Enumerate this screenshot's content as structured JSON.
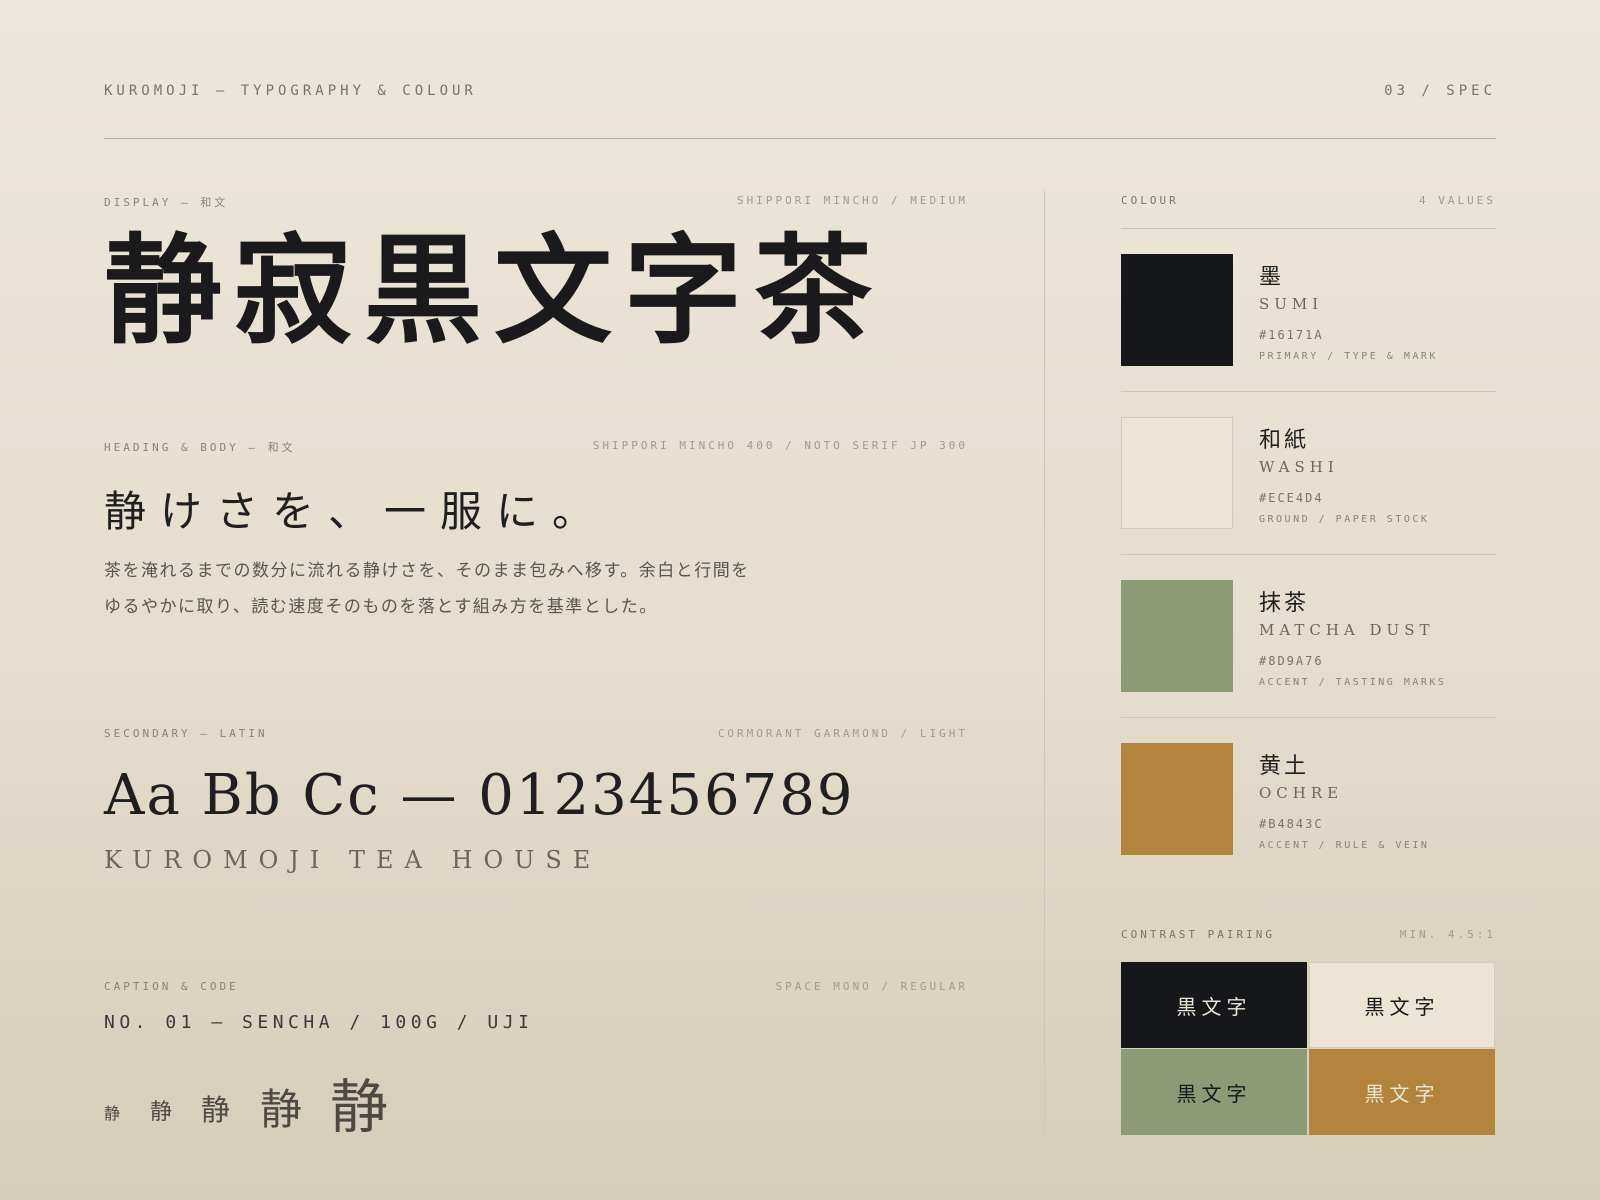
{
  "header": {
    "left": "KUROMOJI — TYPOGRAPHY & COLOUR",
    "right": "03 / SPEC"
  },
  "display": {
    "label": "DISPLAY — 和文",
    "font": "SHIPPORI MINCHO / MEDIUM",
    "sample": "静寂黒文字茶"
  },
  "heading_body": {
    "label": "HEADING & BODY — 和文",
    "font": "SHIPPORI MINCHO 400 / NOTO SERIF JP 300",
    "heading": "静けさを、一服に。",
    "body": "茶を淹れるまでの数分に流れる静けさを、そのまま包みへ移す。余白と行間をゆるやかに取り、読む速度そのものを落とす組み方を基準とした。"
  },
  "secondary": {
    "label": "SECONDARY — LATIN",
    "font": "CORMORANT GARAMOND / LIGHT",
    "sample": "Aa Bb Cc — 0123456789",
    "caps": "KUROMOJI TEA HOUSE"
  },
  "caption": {
    "label": "CAPTION & CODE",
    "font": "SPACE MONO / REGULAR",
    "sample": "NO. 01 — SENCHA / 100G / UJI",
    "scale": [
      "静",
      "静",
      "静",
      "静",
      "静"
    ]
  },
  "colour": {
    "label": "COLOUR",
    "count": "4 VALUES",
    "swatches": [
      {
        "name": "墨",
        "roman": "SUMI",
        "hex": "#16171A",
        "role": "PRIMARY / TYPE & MARK"
      },
      {
        "name": "和紙",
        "roman": "WASHI",
        "hex": "#ECE4D4",
        "role": "GROUND / PAPER STOCK"
      },
      {
        "name": "抹茶",
        "roman": "MATCHA DUST",
        "hex": "#8D9A76",
        "role": "ACCENT / TASTING MARKS"
      },
      {
        "name": "黄土",
        "roman": "OCHRE",
        "hex": "#B4843C",
        "role": "ACCENT / RULE & VEIN"
      }
    ]
  },
  "contrast": {
    "label": "CONTRAST PAIRING",
    "min": "MIN. 4.5:1",
    "pairs": [
      {
        "text": "黒文字",
        "bg": "#16171A",
        "fg": "#ECE4D4"
      },
      {
        "text": "黒文字",
        "bg": "#ECE4D4",
        "fg": "#16171A"
      },
      {
        "text": "黒文字",
        "bg": "#8D9A76",
        "fg": "#16171A"
      },
      {
        "text": "黒文字",
        "bg": "#B4843C",
        "fg": "#ECE4D4"
      }
    ]
  }
}
